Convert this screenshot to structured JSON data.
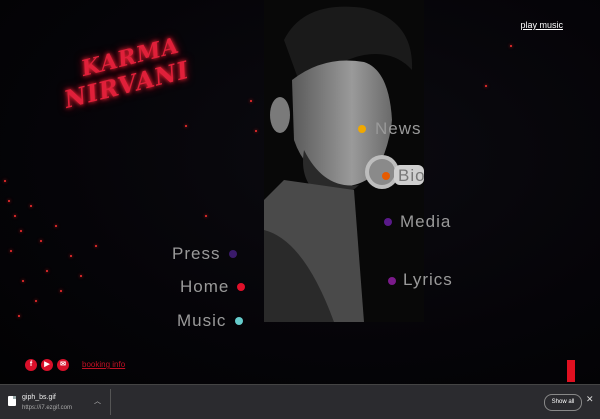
{
  "header": {
    "play_music": "play music"
  },
  "logo": {
    "line1": "KARMA",
    "line2": "NIRVANI"
  },
  "nav": [
    {
      "label": "News",
      "dot_color": "#f0a800"
    },
    {
      "label": "Bio",
      "dot_color": "#e65b00"
    },
    {
      "label": "Media",
      "dot_color": "#5a1a8a"
    },
    {
      "label": "Lyrics",
      "dot_color": "#7a1a8a"
    },
    {
      "label": "Press",
      "dot_color": "#3a1a6a"
    },
    {
      "label": "Home",
      "dot_color": "#e0102a"
    },
    {
      "label": "Music",
      "dot_color": "#66cccc"
    }
  ],
  "footer": {
    "social": [
      "f",
      "yt",
      "mail"
    ],
    "booking": "booking info"
  },
  "downloads": {
    "filename": "giph_bs.gif",
    "url": "https://i7.ezgif.com",
    "show_all": "Show all"
  },
  "colors": {
    "accent": "#e01020",
    "background": "#040306"
  }
}
